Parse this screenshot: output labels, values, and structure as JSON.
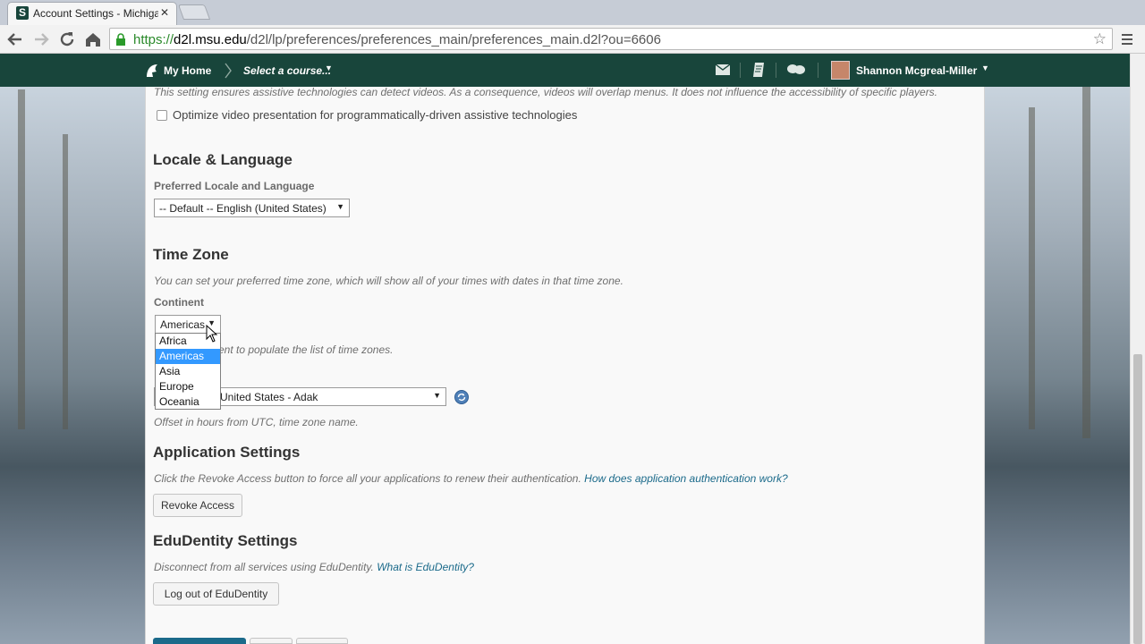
{
  "browser": {
    "tab_title": "Account Settings - Michigan State University",
    "tab_favicon": "S",
    "url_scheme": "https://",
    "url_host": "d2l.msu.edu",
    "url_path": "/d2l/lp/preferences/preferences_main/preferences_main.d2l?ou=6606"
  },
  "navbar": {
    "home": "My Home",
    "course_selector": "Select a course...",
    "user_name": "Shannon Mcgreal-Miller",
    "bg_color": "#18453b"
  },
  "video": {
    "note": "This setting ensures assistive technologies can detect videos. As a consequence, videos will overlap menus. It does not influence the accessibility of specific players.",
    "checkbox_label": "Optimize video presentation for programmatically-driven assistive technologies"
  },
  "locale": {
    "heading": "Locale & Language",
    "label": "Preferred Locale and Language",
    "value": "-- Default -- English (United States)"
  },
  "timezone": {
    "heading": "Time Zone",
    "note": "You can set your preferred time zone, which will show all of your times with dates in that time zone.",
    "continent_label": "Continent",
    "continent_value": "Americas",
    "hint_visible": "ent to populate the list of time zones.",
    "zone_value": "United States - Adak",
    "offset_note": "Offset in hours from UTC, time zone name.",
    "options": [
      "Africa",
      "Americas",
      "Asia",
      "Europe",
      "Oceania"
    ],
    "selected_option": "Americas"
  },
  "app_settings": {
    "heading": "Application Settings",
    "note": "Click the Revoke Access button to force all your applications to renew their authentication.",
    "link": "How does application authentication work?",
    "button": "Revoke Access"
  },
  "edudentity": {
    "heading": "EduDentity Settings",
    "note": "Disconnect from all services using EduDentity.",
    "link": "What is EduDentity?",
    "button": "Log out of EduDentity"
  }
}
